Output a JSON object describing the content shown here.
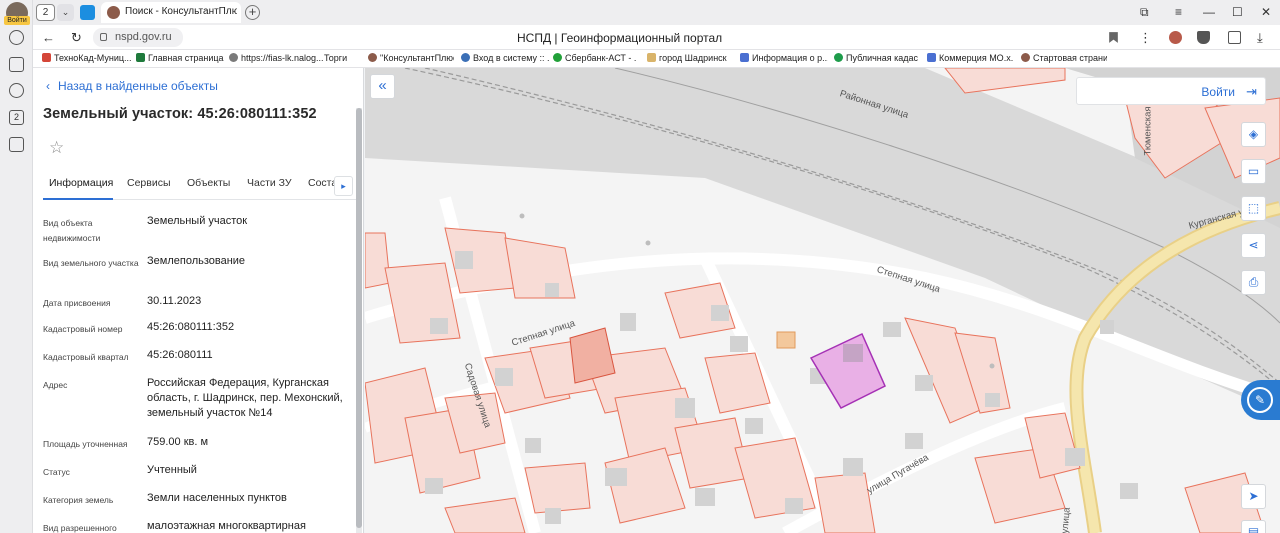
{
  "browser": {
    "sidebar_login_label": "Войти",
    "tab_count": "2",
    "tab_title": "Поиск - КонсультантПлюс",
    "url": "nspd.gov.ru",
    "page_title": "НСПД | Геоинформационный портал",
    "bookmarks": [
      "ТехноКад-Муниц...",
      "Главная страница",
      "https://fias-lk.nalog...",
      "Торги",
      "\"КонсультантПлюс\"",
      "Вход в систему :: ...",
      "Сбербанк-АСТ - ...",
      "город Шадринск",
      "Информация о р...",
      "Публичная кадаст...",
      "Коммерция МО.х...",
      "Стартовая страни..."
    ]
  },
  "panel": {
    "back_label": "Назад в найденные объекты",
    "title": "Земельный участок: 45:26:080111:352",
    "tabs": [
      "Информация",
      "Сервисы",
      "Объекты",
      "Части ЗУ",
      "Соста"
    ],
    "attributes": [
      {
        "key": "Вид объекта недвижимости",
        "value": "Земельный участок"
      },
      {
        "key": "Вид земельного участка",
        "value": "Землепользование"
      },
      {
        "key": "Дата присвоения",
        "value": "30.11.2023"
      },
      {
        "key": "Кадастровый номер",
        "value": "45:26:080111:352"
      },
      {
        "key": "Кадастровый квартал",
        "value": "45:26:080111"
      },
      {
        "key": "Адрес",
        "value": "Российская Федерация, Курганская область, г. Шадринск, пер. Мехонский, земельный участок №14"
      },
      {
        "key": "Площадь уточненная",
        "value": "759.00 кв. м"
      },
      {
        "key": "Статус",
        "value": "Учтенный"
      },
      {
        "key": "Категория земель",
        "value": "Земли населенных пунктов"
      },
      {
        "key": "Вид разрешенного",
        "value": "малоэтажная многоквартирная"
      }
    ]
  },
  "map": {
    "login_label": "Войти",
    "street_labels": [
      "Районная улица",
      "Степная улица",
      "Степная улица",
      "Садовая улица",
      "улица Пугачёва",
      "Тюменская",
      "Курганская ул",
      "улица"
    ]
  },
  "colors": {
    "accent": "#2d6fd4",
    "parcel_stroke": "#e8735c",
    "parcel_fill": "#f7d9d2",
    "selected_stroke": "#a531b5",
    "selected_fill": "#e9a6e3",
    "road_yellow": "#f3e0a0"
  }
}
